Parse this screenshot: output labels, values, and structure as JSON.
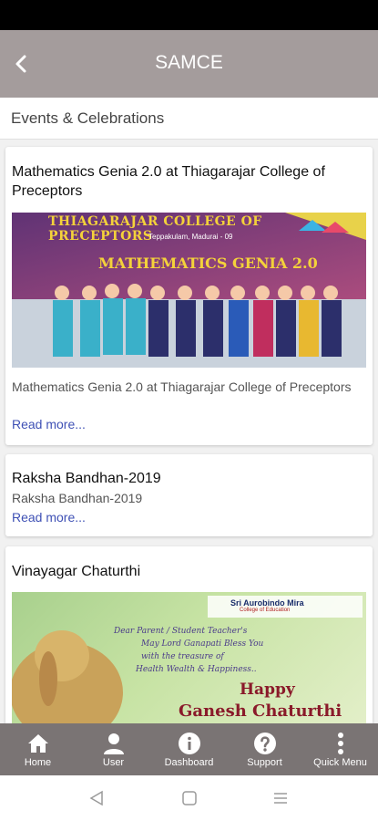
{
  "app_bar": {
    "title": "SAMCE"
  },
  "section": {
    "title": "Events & Celebrations"
  },
  "events": [
    {
      "title": "Mathematics Genia 2.0 at Thiagarajar College of Preceptors",
      "description": "Mathematics Genia 2.0 at Thiagarajar College of Preceptors",
      "read_more": "Read more...",
      "banner_line1": "THIAGARAJAR COLLEGE OF PRECEPTORS",
      "banner_line2": "Teppakulam, Madurai - 09",
      "banner_line3": "MATHEMATICS GENIA 2.0"
    },
    {
      "title": "Raksha Bandhan-2019",
      "description": "Raksha Bandhan-2019",
      "read_more": "Read more..."
    },
    {
      "title": "Vinayagar Chaturthi",
      "poster_org": "Sri Aurobindo Mira",
      "poster_org_sub": "College of Education",
      "poster_msg1": "Dear Parent / Student Teacher's",
      "poster_msg2": "May Lord Ganapati Bless You",
      "poster_msg3": "with the treasure of",
      "poster_msg4": "Health Wealth & Happiness..",
      "poster_happy": "Happy",
      "poster_festival": "Ganesh Chaturthi"
    }
  ],
  "bottom_nav": [
    {
      "label": "Home",
      "icon": "home-icon"
    },
    {
      "label": "User",
      "icon": "user-icon"
    },
    {
      "label": "Dashboard",
      "icon": "info-icon"
    },
    {
      "label": "Support",
      "icon": "help-icon"
    },
    {
      "label": "Quick Menu",
      "icon": "more-vertical-icon"
    }
  ],
  "colors": {
    "app_bar": "#a49c9c",
    "bottom_nav": "#7a7474",
    "link": "#3f51b5"
  }
}
